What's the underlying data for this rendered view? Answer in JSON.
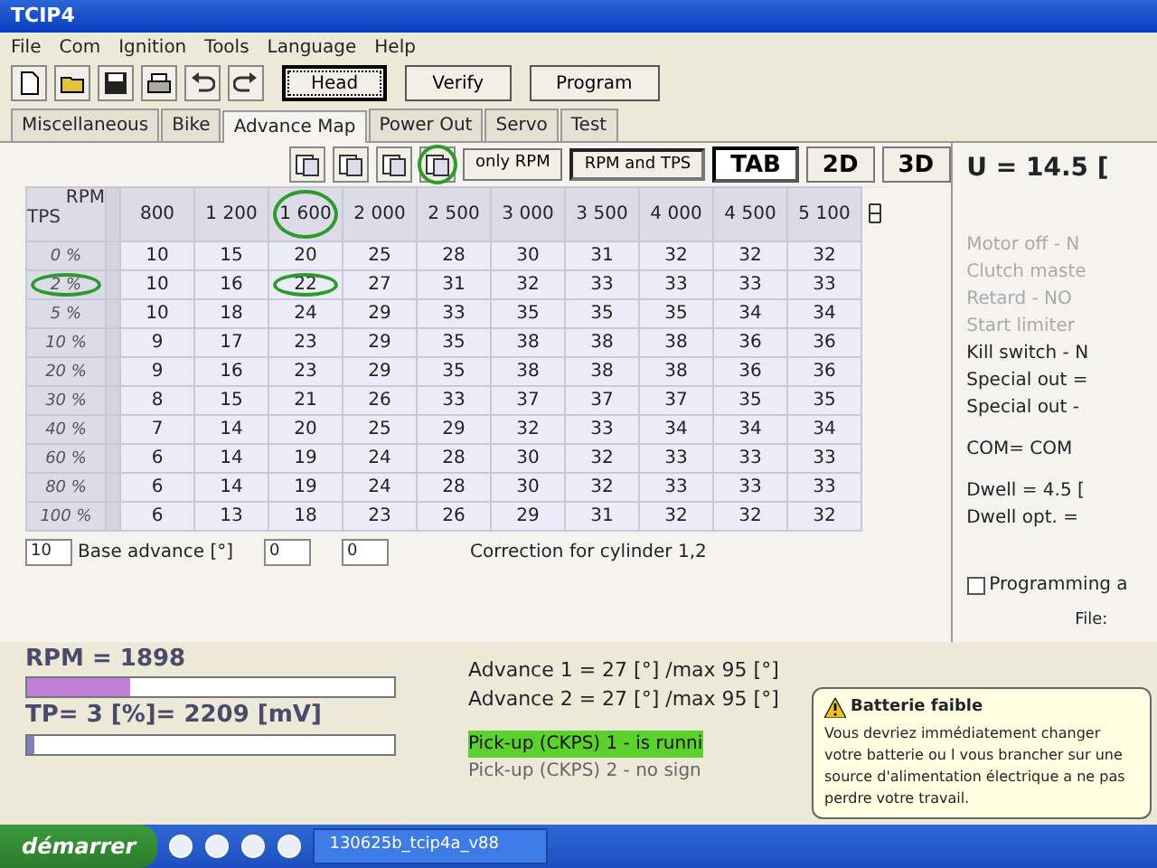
{
  "window": {
    "title": "TCIP4"
  },
  "menu": [
    "File",
    "Com",
    "Ignition",
    "Tools",
    "Language",
    "Help"
  ],
  "toolbar": {
    "buttons": [
      {
        "label": "Head",
        "selected": true
      },
      {
        "label": "Verify",
        "selected": false
      },
      {
        "label": "Program",
        "selected": false
      }
    ]
  },
  "tabs": [
    {
      "label": "Miscellaneous",
      "selected": false
    },
    {
      "label": "Bike",
      "selected": false
    },
    {
      "label": "Advance Map",
      "selected": true
    },
    {
      "label": "Power Out",
      "selected": false
    },
    {
      "label": "Servo",
      "selected": false
    },
    {
      "label": "Test",
      "selected": false
    }
  ],
  "map_toolbar": [
    {
      "kind": "icon",
      "circled": false
    },
    {
      "kind": "icon",
      "circled": false
    },
    {
      "kind": "icon",
      "circled": false
    },
    {
      "kind": "icon",
      "circled": true
    },
    {
      "kind": "text",
      "label": "only RPM",
      "selected": false
    },
    {
      "kind": "text",
      "label": "RPM and TPS",
      "selected": true
    },
    {
      "kind": "view",
      "label": "TAB",
      "selected": true
    },
    {
      "kind": "view",
      "label": "2D",
      "selected": false
    },
    {
      "kind": "view",
      "label": "3D",
      "selected": false
    }
  ],
  "table": {
    "corner_top": "RPM",
    "corner_bottom": "TPS",
    "columns": [
      {
        "label": "800",
        "circled": false
      },
      {
        "label": "1 200",
        "circled": false
      },
      {
        "label": "1 600",
        "circled": true
      },
      {
        "label": "2 000",
        "circled": false
      },
      {
        "label": "2 500",
        "circled": false
      },
      {
        "label": "3 000",
        "circled": false
      },
      {
        "label": "3 500",
        "circled": false
      },
      {
        "label": "4 000",
        "circled": false
      },
      {
        "label": "4 500",
        "circled": false
      },
      {
        "label": "5 100",
        "circled": false
      }
    ],
    "rows": [
      {
        "label": "0 %",
        "circled": false,
        "cells": [
          "10",
          "15",
          "20",
          "25",
          "28",
          "30",
          "31",
          "32",
          "32",
          "32"
        ]
      },
      {
        "label": "2 %",
        "circled": true,
        "cells": [
          "10",
          "16",
          {
            "value": "22",
            "circled": true
          },
          "27",
          "31",
          "32",
          "33",
          "33",
          "33",
          "33"
        ]
      },
      {
        "label": "5 %",
        "circled": false,
        "cells": [
          "10",
          "18",
          "24",
          "29",
          "33",
          "35",
          "35",
          "35",
          "34",
          "34"
        ]
      },
      {
        "label": "10 %",
        "circled": false,
        "cells": [
          "9",
          "17",
          "23",
          "29",
          "35",
          "38",
          "38",
          "38",
          "36",
          "36"
        ]
      },
      {
        "label": "20 %",
        "circled": false,
        "cells": [
          "9",
          "16",
          "23",
          "29",
          "35",
          "38",
          "38",
          "38",
          "36",
          "36"
        ]
      },
      {
        "label": "30 %",
        "circled": false,
        "cells": [
          "8",
          "15",
          "21",
          "26",
          "33",
          "37",
          "37",
          "37",
          "35",
          "35"
        ]
      },
      {
        "label": "40 %",
        "circled": false,
        "cells": [
          "7",
          "14",
          "20",
          "25",
          "29",
          "32",
          "33",
          "34",
          "34",
          "34"
        ]
      },
      {
        "label": "60 %",
        "circled": false,
        "cells": [
          "6",
          "14",
          "19",
          "24",
          "28",
          "30",
          "32",
          "33",
          "33",
          "33"
        ]
      },
      {
        "label": "80 %",
        "circled": false,
        "cells": [
          "6",
          "14",
          "19",
          "24",
          "28",
          "30",
          "32",
          "33",
          "33",
          "33"
        ]
      },
      {
        "label": "100 %",
        "circled": false,
        "cells": [
          "6",
          "13",
          "18",
          "23",
          "26",
          "29",
          "31",
          "32",
          "32",
          "32"
        ]
      }
    ]
  },
  "right_panel": {
    "voltage": "U = 14.5 [",
    "status": [
      {
        "text": "Motor off - N",
        "disabled": true
      },
      {
        "text": "Clutch maste",
        "disabled": true
      },
      {
        "text": "Retard - NO",
        "disabled": true
      },
      {
        "text": "Start limiter",
        "disabled": true
      },
      {
        "text": "Kill switch - N",
        "disabled": false
      },
      {
        "text": "Special out =",
        "disabled": false
      },
      {
        "text": "Special out -",
        "disabled": false
      }
    ],
    "com": "COM= COM",
    "dwell": [
      "Dwell = 4.5 [",
      "Dwell opt. ="
    ]
  },
  "base_advance": {
    "value": "10",
    "label": "Base advance [°]"
  },
  "correction": {
    "values": [
      "0",
      "0"
    ],
    "label": "Correction for cylinder 1,2"
  },
  "programming": {
    "label": "Programming a",
    "checked": false
  },
  "rpm": {
    "text": "RPM = 1898",
    "level": 0.28
  },
  "tp": {
    "text": "TP= 3 [%]= 2209 [mV]",
    "level": 0.02
  },
  "advance": [
    "Advance 1 = 27 [°] /max 95 [°]",
    "Advance 2 = 27 [°] /max 95 [°]"
  ],
  "file": "File:",
  "pickups": [
    {
      "text": "Pick-up (CKPS) 1 - is runni",
      "highlighted": true
    },
    {
      "text": "Pick-up (CKPS) 2 - no sign",
      "highlighted": false
    }
  ],
  "notification": {
    "title": "Batterie faible",
    "text": "Vous devriez immédiatement changer votre batterie ou l vous brancher sur une source d'alimentation électrique a ne pas perdre votre travail."
  },
  "taskbar": {
    "start": "démarrer",
    "tasks": [
      "130625b_tcip4a_v88"
    ]
  }
}
